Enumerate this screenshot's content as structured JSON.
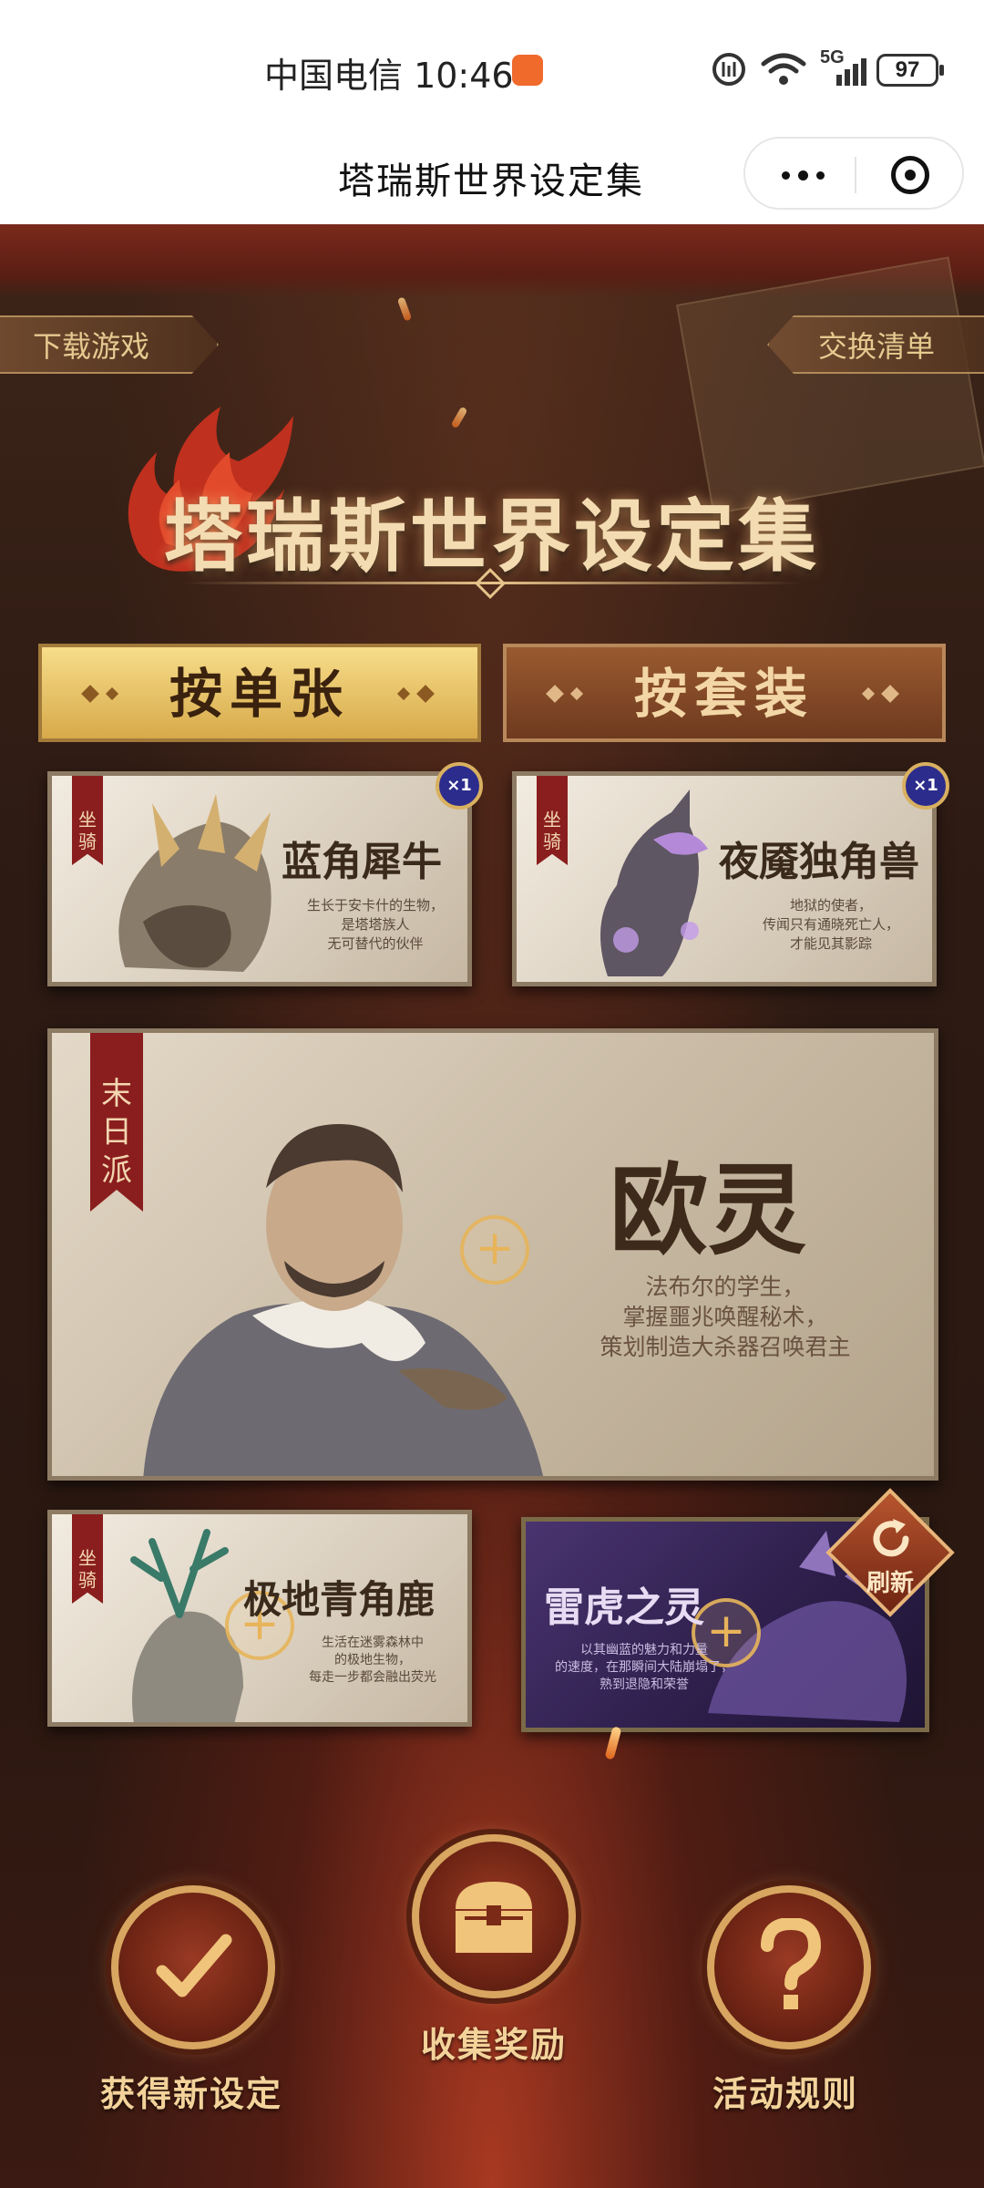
{
  "status_bar": {
    "carrier_time": "中国电信 10:46",
    "network": "5G",
    "battery": "97"
  },
  "header": {
    "title": "塔瑞斯世界设定集"
  },
  "page": {
    "download_tab": "下载游戏",
    "exchange_tab": "交换清单",
    "title": "塔瑞斯世界设定集",
    "mode_single": "按单张",
    "mode_set": "按套装"
  },
  "cards": {
    "c1": {
      "tag": "坐骑",
      "name": "蓝角犀牛",
      "desc": "生长于安卡什的生物，\n是塔塔族人\n无可替代的伙伴",
      "badge": "×1"
    },
    "c2": {
      "tag": "坐骑",
      "name": "夜魇独角兽",
      "desc": "地狱的使者，\n传闻只有通晓死亡人，\n才能见其影踪",
      "badge": "×1"
    },
    "c3": {
      "tag": "末日派",
      "name": "欧灵",
      "desc": "法布尔的学生，\n掌握噩兆唤醒秘术，\n策划制造大杀器召唤君主"
    },
    "c4": {
      "tag": "坐骑",
      "name": "极地青角鹿",
      "desc": "生活在迷雾森林中\n的极地生物，\n每走一步都会融出荧光"
    },
    "c5": {
      "name": "雷虎之灵",
      "desc": "以其幽蓝的魅力和力量\n的速度，在那瞬间大陆崩塌了，\n熟到退隐和荣誉"
    }
  },
  "refresh_label": "刷新",
  "bottom_nav": {
    "new": "获得新设定",
    "collect": "收集奖励",
    "rules": "活动规则"
  },
  "colors": {
    "gold": "#e6c38a",
    "banner_red": "#8a1e1e",
    "badge_blue": "#2c2c8c"
  }
}
